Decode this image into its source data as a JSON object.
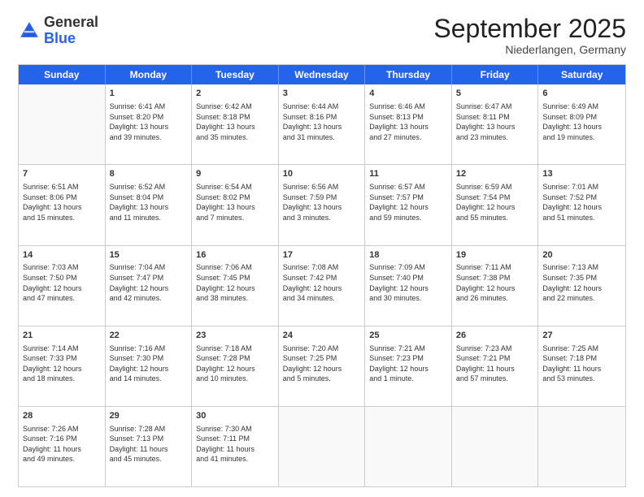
{
  "header": {
    "logo": {
      "general": "General",
      "blue": "Blue"
    },
    "title": "September 2025",
    "subtitle": "Niederlangen, Germany"
  },
  "weekdays": [
    "Sunday",
    "Monday",
    "Tuesday",
    "Wednesday",
    "Thursday",
    "Friday",
    "Saturday"
  ],
  "rows": [
    [
      {
        "day": "",
        "info": ""
      },
      {
        "day": "1",
        "info": "Sunrise: 6:41 AM\nSunset: 8:20 PM\nDaylight: 13 hours\nand 39 minutes."
      },
      {
        "day": "2",
        "info": "Sunrise: 6:42 AM\nSunset: 8:18 PM\nDaylight: 13 hours\nand 35 minutes."
      },
      {
        "day": "3",
        "info": "Sunrise: 6:44 AM\nSunset: 8:16 PM\nDaylight: 13 hours\nand 31 minutes."
      },
      {
        "day": "4",
        "info": "Sunrise: 6:46 AM\nSunset: 8:13 PM\nDaylight: 13 hours\nand 27 minutes."
      },
      {
        "day": "5",
        "info": "Sunrise: 6:47 AM\nSunset: 8:11 PM\nDaylight: 13 hours\nand 23 minutes."
      },
      {
        "day": "6",
        "info": "Sunrise: 6:49 AM\nSunset: 8:09 PM\nDaylight: 13 hours\nand 19 minutes."
      }
    ],
    [
      {
        "day": "7",
        "info": "Sunrise: 6:51 AM\nSunset: 8:06 PM\nDaylight: 13 hours\nand 15 minutes."
      },
      {
        "day": "8",
        "info": "Sunrise: 6:52 AM\nSunset: 8:04 PM\nDaylight: 13 hours\nand 11 minutes."
      },
      {
        "day": "9",
        "info": "Sunrise: 6:54 AM\nSunset: 8:02 PM\nDaylight: 13 hours\nand 7 minutes."
      },
      {
        "day": "10",
        "info": "Sunrise: 6:56 AM\nSunset: 7:59 PM\nDaylight: 13 hours\nand 3 minutes."
      },
      {
        "day": "11",
        "info": "Sunrise: 6:57 AM\nSunset: 7:57 PM\nDaylight: 12 hours\nand 59 minutes."
      },
      {
        "day": "12",
        "info": "Sunrise: 6:59 AM\nSunset: 7:54 PM\nDaylight: 12 hours\nand 55 minutes."
      },
      {
        "day": "13",
        "info": "Sunrise: 7:01 AM\nSunset: 7:52 PM\nDaylight: 12 hours\nand 51 minutes."
      }
    ],
    [
      {
        "day": "14",
        "info": "Sunrise: 7:03 AM\nSunset: 7:50 PM\nDaylight: 12 hours\nand 47 minutes."
      },
      {
        "day": "15",
        "info": "Sunrise: 7:04 AM\nSunset: 7:47 PM\nDaylight: 12 hours\nand 42 minutes."
      },
      {
        "day": "16",
        "info": "Sunrise: 7:06 AM\nSunset: 7:45 PM\nDaylight: 12 hours\nand 38 minutes."
      },
      {
        "day": "17",
        "info": "Sunrise: 7:08 AM\nSunset: 7:42 PM\nDaylight: 12 hours\nand 34 minutes."
      },
      {
        "day": "18",
        "info": "Sunrise: 7:09 AM\nSunset: 7:40 PM\nDaylight: 12 hours\nand 30 minutes."
      },
      {
        "day": "19",
        "info": "Sunrise: 7:11 AM\nSunset: 7:38 PM\nDaylight: 12 hours\nand 26 minutes."
      },
      {
        "day": "20",
        "info": "Sunrise: 7:13 AM\nSunset: 7:35 PM\nDaylight: 12 hours\nand 22 minutes."
      }
    ],
    [
      {
        "day": "21",
        "info": "Sunrise: 7:14 AM\nSunset: 7:33 PM\nDaylight: 12 hours\nand 18 minutes."
      },
      {
        "day": "22",
        "info": "Sunrise: 7:16 AM\nSunset: 7:30 PM\nDaylight: 12 hours\nand 14 minutes."
      },
      {
        "day": "23",
        "info": "Sunrise: 7:18 AM\nSunset: 7:28 PM\nDaylight: 12 hours\nand 10 minutes."
      },
      {
        "day": "24",
        "info": "Sunrise: 7:20 AM\nSunset: 7:25 PM\nDaylight: 12 hours\nand 5 minutes."
      },
      {
        "day": "25",
        "info": "Sunrise: 7:21 AM\nSunset: 7:23 PM\nDaylight: 12 hours\nand 1 minute."
      },
      {
        "day": "26",
        "info": "Sunrise: 7:23 AM\nSunset: 7:21 PM\nDaylight: 11 hours\nand 57 minutes."
      },
      {
        "day": "27",
        "info": "Sunrise: 7:25 AM\nSunset: 7:18 PM\nDaylight: 11 hours\nand 53 minutes."
      }
    ],
    [
      {
        "day": "28",
        "info": "Sunrise: 7:26 AM\nSunset: 7:16 PM\nDaylight: 11 hours\nand 49 minutes."
      },
      {
        "day": "29",
        "info": "Sunrise: 7:28 AM\nSunset: 7:13 PM\nDaylight: 11 hours\nand 45 minutes."
      },
      {
        "day": "30",
        "info": "Sunrise: 7:30 AM\nSunset: 7:11 PM\nDaylight: 11 hours\nand 41 minutes."
      },
      {
        "day": "",
        "info": ""
      },
      {
        "day": "",
        "info": ""
      },
      {
        "day": "",
        "info": ""
      },
      {
        "day": "",
        "info": ""
      }
    ]
  ]
}
